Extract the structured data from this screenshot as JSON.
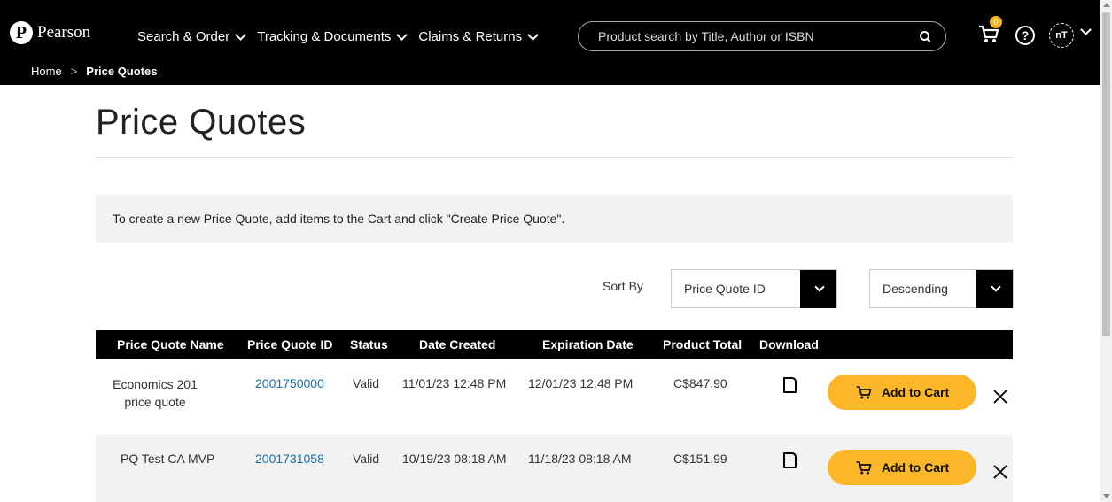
{
  "header": {
    "logo_text": "Pearson",
    "nav": [
      {
        "label": "Search & Order"
      },
      {
        "label": "Tracking & Documents"
      },
      {
        "label": "Claims & Returns"
      }
    ],
    "search_placeholder": "Product search by Title, Author or ISBN",
    "cart_count": "0",
    "help_glyph": "?",
    "avatar_initials": "nT"
  },
  "breadcrumb": {
    "home": "Home",
    "separator": ">",
    "current": "Price Quotes"
  },
  "page": {
    "title": "Price Quotes",
    "info_text": "To create a new Price Quote, add items to the Cart and click \"Create Price Quote\"."
  },
  "sort": {
    "label": "Sort By",
    "field_value": "Price Quote ID",
    "order_value": "Descending"
  },
  "table": {
    "columns": [
      "Price Quote Name",
      "Price Quote ID",
      "Status",
      "Date Created",
      "Expiration Date",
      "Product Total",
      "Download"
    ],
    "rows": [
      {
        "name": "Economics 201 price quote",
        "id": "2001750000",
        "status": "Valid",
        "created": "11/01/23 12:48 PM",
        "expires": "12/01/23 12:48 PM",
        "total": "C$847.90",
        "action": "Add to Cart"
      },
      {
        "name": "PQ Test CA MVP",
        "id": "2001731058",
        "status": "Valid",
        "created": "10/19/23 08:18 AM",
        "expires": "11/18/23 08:18 AM",
        "total": "C$151.99",
        "action": "Add to Cart"
      }
    ]
  },
  "icons": {
    "logo": "pearson-logo-icon",
    "search": "search-icon",
    "cart": "cart-icon",
    "help": "help-icon",
    "download": "document-icon",
    "remove": "close-icon"
  },
  "colors": {
    "header_bg": "#000000",
    "accent": "#fcb629",
    "link": "#1a6fa3",
    "info_bg": "#f2f2f2"
  }
}
